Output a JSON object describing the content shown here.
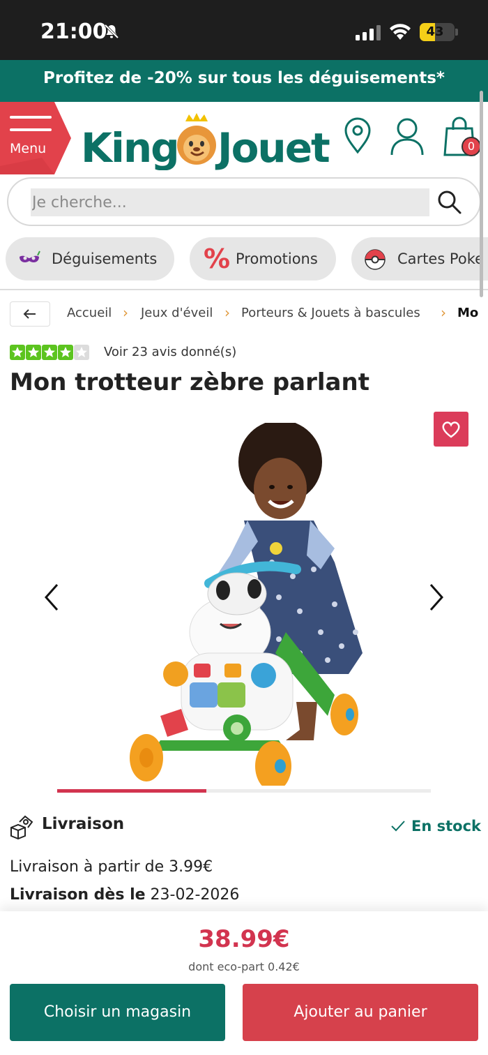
{
  "status_bar": {
    "time": "21:00",
    "battery": "43",
    "battery_level": 0.43
  },
  "promo_banner": {
    "text": "Profitez de -20% sur tous les déguisements*"
  },
  "header": {
    "menu_label": "Menu",
    "logo_text": "KingJouet",
    "cart_count": "0"
  },
  "search": {
    "placeholder": "Je cherche..."
  },
  "categories": [
    {
      "label": "Déguisements",
      "icon": "mask-icon"
    },
    {
      "label": "Promotions",
      "icon": "percent-icon"
    },
    {
      "label": "Cartes Poke",
      "icon": "pokeball-icon"
    }
  ],
  "breadcrumb": {
    "items": [
      "Accueil",
      "Jeux d'éveil",
      "Porteurs & Jouets à bascules",
      "Mo"
    ]
  },
  "product": {
    "rating": 4,
    "rating_max": 5,
    "reviews_text": "Voir 23 avis donné(s)",
    "title": "Mon trotteur zèbre parlant",
    "gallery_progress": 0.4
  },
  "delivery": {
    "heading": "Livraison",
    "stock": "En stock",
    "from_text": "Livraison à partir de 3.99€",
    "date_label": "Livraison dès le",
    "date_value": " 23-02-2026"
  },
  "purchase": {
    "price": "38.99€",
    "eco_part": "dont eco-part 0.42€",
    "store_button": "Choisir un magasin",
    "cart_button": "Ajouter au panier"
  },
  "colors": {
    "brand_teal": "#0c7165",
    "accent_red": "#d6414c",
    "rating_green": "#5cc41f"
  }
}
